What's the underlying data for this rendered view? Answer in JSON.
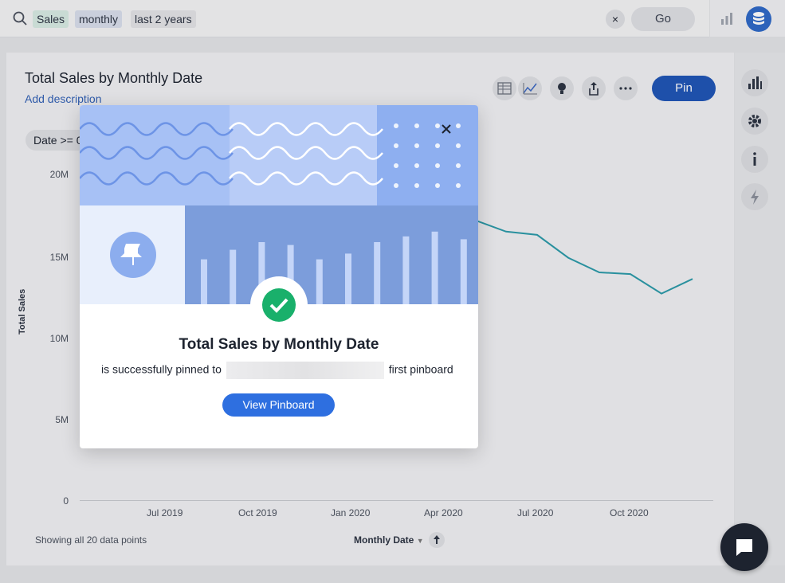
{
  "search": {
    "tokens": [
      "Sales",
      "monthly",
      "last 2 years"
    ],
    "clear_label": "×",
    "go_label": "Go"
  },
  "chart_header": {
    "title": "Total Sales by Monthly Date",
    "add_description": "Add description",
    "pin_label": "Pin",
    "filter_chip": "Date >= 0"
  },
  "chart_data": {
    "type": "line",
    "title": "Total Sales by Monthly Date",
    "xlabel": "Monthly Date",
    "ylabel": "Total Sales",
    "y_ticks": [
      "0",
      "5M",
      "10M",
      "15M",
      "20M"
    ],
    "x_ticks": [
      "Jul 2019",
      "Oct 2019",
      "Jan 2020",
      "Apr 2020",
      "Jul 2020",
      "Oct 2020"
    ],
    "ylim": [
      0,
      20000000
    ],
    "visible_series_points": {
      "x": [
        "Apr 2020",
        "May 2020",
        "Jun 2020",
        "Jul 2020",
        "Aug 2020",
        "Sep 2020",
        "Oct 2020",
        "Nov 2020",
        "Dec 2020"
      ],
      "y": [
        17700000,
        17200000,
        16500000,
        16300000,
        14900000,
        14000000,
        13900000,
        12700000,
        13600000
      ]
    },
    "color": "#2a9aa8"
  },
  "footer": {
    "note": "Showing all 20 data points",
    "x_axis_label": "Monthly Date"
  },
  "modal": {
    "title": "Total Sales by Monthly Date",
    "pinned_prefix": "is successfully pinned to",
    "pinned_suffix": "first pinboard",
    "view_button": "View Pinboard",
    "illustration_bars": [
      0.47,
      0.57,
      0.65,
      0.62,
      0.47,
      0.53,
      0.65,
      0.71,
      0.76,
      0.68
    ]
  },
  "colors": {
    "primary": "#1e54b5",
    "button_blue": "#2e6fe0",
    "success": "#19b06b",
    "line": "#2a9aa8"
  }
}
